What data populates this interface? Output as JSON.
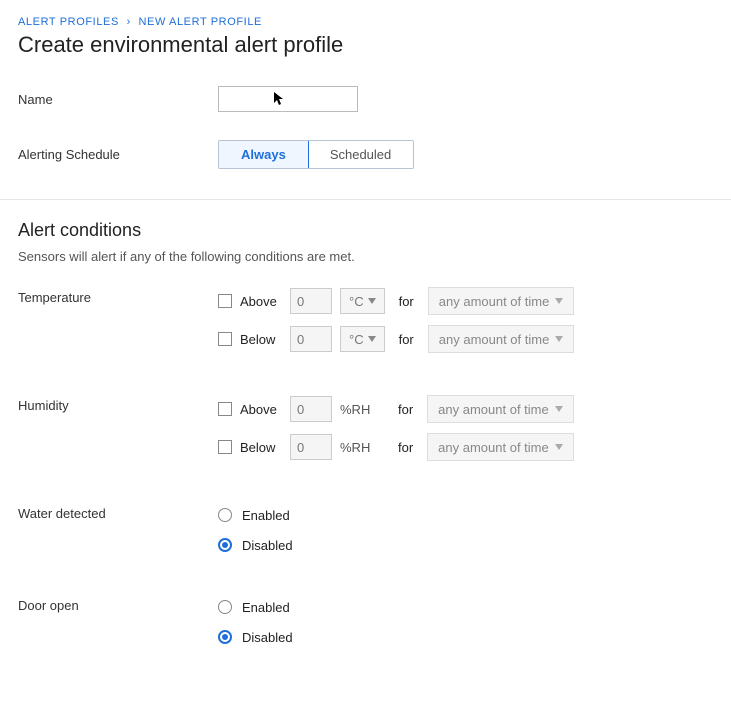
{
  "breadcrumb": {
    "parent": "ALERT PROFILES",
    "current": "NEW ALERT PROFILE"
  },
  "page_title": "Create environmental alert profile",
  "fields": {
    "name_label": "Name",
    "name_value": "",
    "schedule_label": "Alerting Schedule",
    "schedule_options": {
      "always": "Always",
      "scheduled": "Scheduled"
    }
  },
  "conditions": {
    "heading": "Alert conditions",
    "subtext": "Sensors will alert if any of the following conditions are met.",
    "for_label": "for",
    "duration_placeholder": "any amount of time",
    "temperature": {
      "label": "Temperature",
      "above": "Above",
      "below": "Below",
      "value_above": "0",
      "value_below": "0",
      "unit": "°C"
    },
    "humidity": {
      "label": "Humidity",
      "above": "Above",
      "below": "Below",
      "value_above": "0",
      "value_below": "0",
      "unit": "%RH"
    },
    "water": {
      "label": "Water detected",
      "enabled": "Enabled",
      "disabled": "Disabled"
    },
    "door": {
      "label": "Door open",
      "enabled": "Enabled",
      "disabled": "Disabled"
    }
  }
}
